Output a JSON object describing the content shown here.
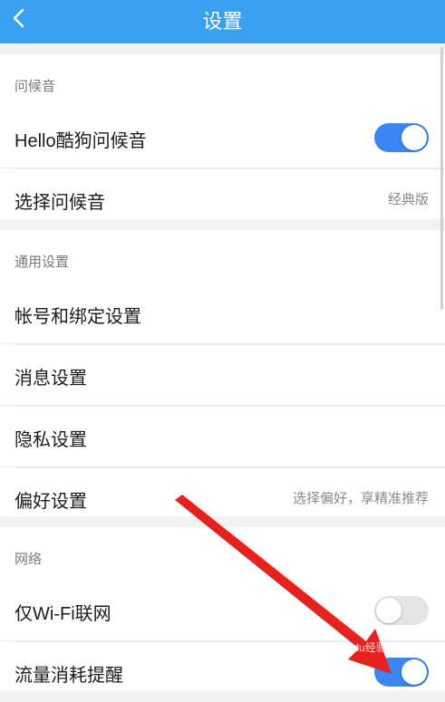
{
  "header": {
    "title": "设置",
    "back_icon": "chevron-left-icon"
  },
  "groups": [
    {
      "title": "问候音",
      "rows": [
        {
          "label": "Hello酷狗问候音",
          "toggle": "on"
        },
        {
          "label": "选择问候音",
          "value": "经典版"
        }
      ]
    },
    {
      "title": "通用设置",
      "rows": [
        {
          "label": "帐号和绑定设置"
        },
        {
          "label": "消息设置"
        },
        {
          "label": "隐私设置"
        },
        {
          "label": "偏好设置",
          "value": "选择偏好，享精准推荐"
        }
      ]
    },
    {
      "title": "网络",
      "rows": [
        {
          "label": "仅Wi-Fi联网",
          "toggle": "off"
        },
        {
          "label": "流量消耗提醒",
          "toggle": "on"
        }
      ]
    }
  ],
  "colors": {
    "header": "#3aa0f0",
    "toggle_on": "#3a86f2",
    "arrow": "#e8211c"
  },
  "watermark": "Baidu经验"
}
